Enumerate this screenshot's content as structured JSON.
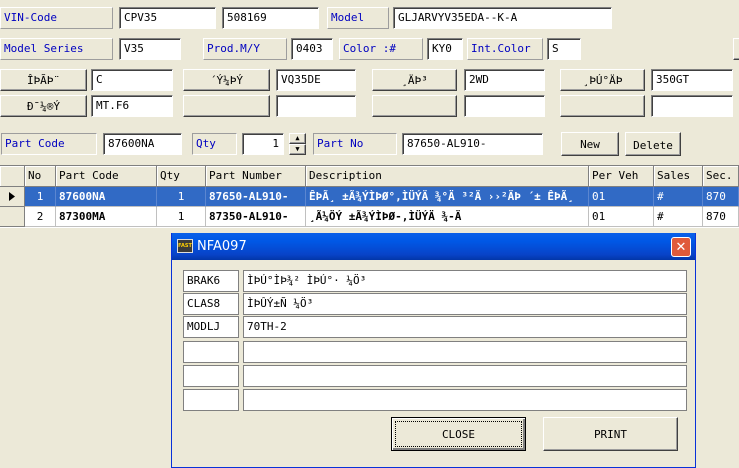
{
  "header": {
    "vin_label": "VIN-Code",
    "vin_value1": "CPV35",
    "vin_value2": "508169",
    "model_label": "Model",
    "model_value": "GLJARVYV35EDA--K-A",
    "series_label": "Model Series",
    "series_value": "V35",
    "prodmy_label": "Prod.M/Y",
    "prodmy_value": "0403",
    "color_label": "Color :#",
    "color_value": "KY0",
    "intcolor_label": "Int.Color",
    "intcolor_value": "S"
  },
  "attributes": {
    "btn1": "ÎÞÃÞ¨",
    "val1": "C",
    "btn2": "´Ý¼ÞÝ",
    "val2": "VQ35DE",
    "btn3": "¸ÄÞ³",
    "val3": "2WD",
    "btn4": "¸ÞÚ°ÄÞ",
    "val4": "350GT",
    "btn5": "Ð¯¼®Ý",
    "val5": "MT.F6",
    "val6": "",
    "val7": "",
    "val8": "",
    "btn6": "",
    "btn7": "",
    "btn8": ""
  },
  "part_entry": {
    "partcode_label": "Part Code",
    "partcode_value": "87600NA",
    "qty_label": "Qty",
    "qty_value": "1",
    "partno_label": "Part No",
    "partno_value": "87650-AL910-",
    "new_label": "New",
    "delete_label": "Delete"
  },
  "grid": {
    "columns": [
      "No",
      "Part Code",
      "Qty",
      "Part Number",
      "Description",
      "Per Veh",
      "Sales",
      "Sec."
    ],
    "rows": [
      {
        "no": "1",
        "code": "87600NA",
        "qty": "1",
        "number": "87650-AL910-",
        "desc": "ÊÞÃ¸ ±Ã¾ÝÌÞØ°,ÌÜÝÄ ¾°Ä ³²Ä ››²ÄÞ ´± ÊÞÃ¸",
        "perveh": "01",
        "sales": "#",
        "sec": "870"
      },
      {
        "no": "2",
        "code": "87300MA",
        "qty": "1",
        "number": "87350-AL910-",
        "desc": "¸Ã¼ÖÝ ±Ã¾ÝÌÞØ-,ÌÜÝÄ ¾-Ä",
        "perveh": "01",
        "sales": "#",
        "sec": "870"
      }
    ]
  },
  "dialog": {
    "icon_text": "FAST",
    "title": "NFA097",
    "rows": [
      {
        "code": "BRAK6",
        "desc": "ÌÞÚ°ÌÞ¾² ÌÞÚ°· ¼Ö³"
      },
      {
        "code": "CLAS8",
        "desc": "ÌÞÛÝ±Ñ ¼Ö³"
      },
      {
        "code": "MODLJ",
        "desc": "70TH-2"
      },
      {
        "code": "",
        "desc": ""
      },
      {
        "code": "",
        "desc": ""
      },
      {
        "code": "",
        "desc": ""
      }
    ],
    "close_label": "CLOSE",
    "print_label": "PRINT"
  },
  "colors": {
    "selection": "#316AC5",
    "label_text": "#0000C0",
    "titlebar": "#0058E6"
  }
}
